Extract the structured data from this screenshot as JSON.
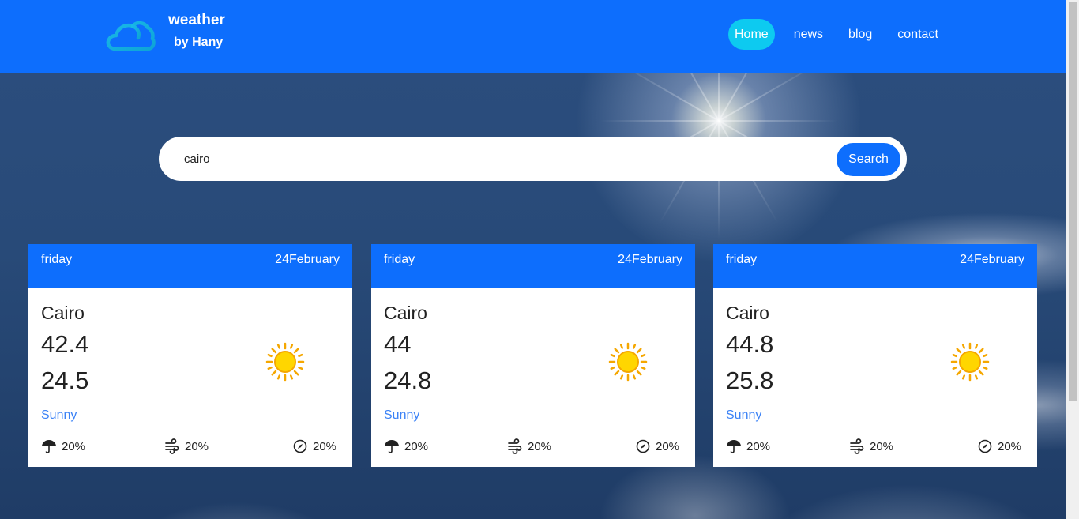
{
  "brand": {
    "title": "weather",
    "subtitle": "by Hany",
    "logo_icon": "cloud-icon"
  },
  "nav": {
    "items": [
      {
        "label": "Home",
        "active": true
      },
      {
        "label": "news",
        "active": false
      },
      {
        "label": "blog",
        "active": false
      },
      {
        "label": "contact",
        "active": false
      }
    ]
  },
  "search": {
    "value": "cairo",
    "button_label": "Search"
  },
  "colors": {
    "primary": "#0d6efd",
    "active_nav": "#0dcaf0",
    "condition_text": "#3b82f6"
  },
  "cards": [
    {
      "day": "friday",
      "date": "24February",
      "city": "Cairo",
      "temp_max": "42.4",
      "temp_min": "24.5",
      "condition": "Sunny",
      "condition_icon": "sun-icon",
      "stats": [
        {
          "icon": "umbrella-icon",
          "value": "20%"
        },
        {
          "icon": "wind-icon",
          "value": "20%"
        },
        {
          "icon": "compass-icon",
          "value": "20%"
        }
      ]
    },
    {
      "day": "friday",
      "date": "24February",
      "city": "Cairo",
      "temp_max": "44",
      "temp_min": "24.8",
      "condition": "Sunny",
      "condition_icon": "sun-icon",
      "stats": [
        {
          "icon": "umbrella-icon",
          "value": "20%"
        },
        {
          "icon": "wind-icon",
          "value": "20%"
        },
        {
          "icon": "compass-icon",
          "value": "20%"
        }
      ]
    },
    {
      "day": "friday",
      "date": "24February",
      "city": "Cairo",
      "temp_max": "44.8",
      "temp_min": "25.8",
      "condition": "Sunny",
      "condition_icon": "sun-icon",
      "stats": [
        {
          "icon": "umbrella-icon",
          "value": "20%"
        },
        {
          "icon": "wind-icon",
          "value": "20%"
        },
        {
          "icon": "compass-icon",
          "value": "20%"
        }
      ]
    }
  ]
}
